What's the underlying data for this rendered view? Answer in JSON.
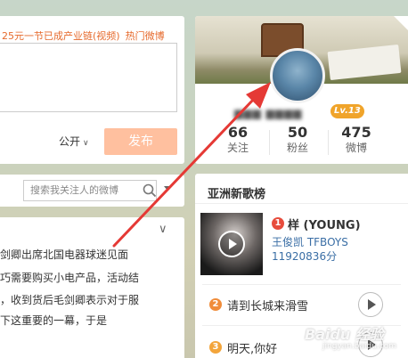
{
  "publish": {
    "hot_topic": "25元一节已成产业链(视频)",
    "hot_weibo_link": "热门微博",
    "visibility": "公开",
    "post_button": "发布"
  },
  "search": {
    "placeholder": "搜索我关注人的微博"
  },
  "feed": {
    "lines": [
      "剑卿出席北国电器球迷见面",
      "巧需要购买小电产品，活动结",
      "，收到货后毛剑卿表示对于服",
      "下这重要的一幕，于是"
    ]
  },
  "profile": {
    "username": "▆▆▆ ▆▆▆▆",
    "level": "Lv.13",
    "stats": [
      {
        "value": "66",
        "label": "关注"
      },
      {
        "value": "50",
        "label": "粉丝"
      },
      {
        "value": "475",
        "label": "微博"
      }
    ]
  },
  "chart": {
    "title": "亚洲新歌榜",
    "songs": [
      {
        "rank": "1",
        "title": "样 (YOUNG)",
        "artist": "王俊凯 TFBOYS",
        "score": "11920836分"
      },
      {
        "rank": "2",
        "title": "请到长城来滑雪"
      },
      {
        "rank": "3",
        "title": "明天,你好"
      }
    ]
  },
  "watermark": {
    "brand": "Baidu 经验",
    "url": "jingyan.baidu.com"
  },
  "colors": {
    "accent_orange": "#e66a2c",
    "post_button_bg": "#ffc09f",
    "level_badge": "#f0a42a",
    "link_blue": "#3a6ea5",
    "annotation_arrow": "#e53935"
  }
}
